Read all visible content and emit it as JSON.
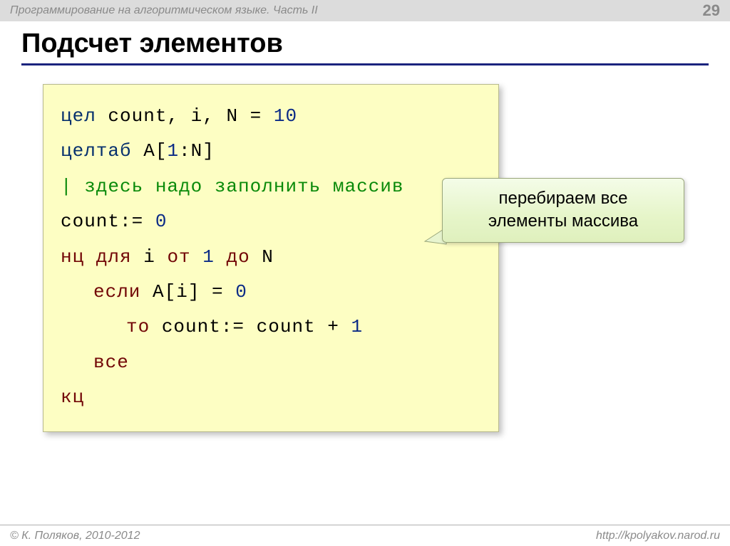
{
  "header": {
    "course": "Программирование на алгоритмическом языке. Часть II",
    "page": "29"
  },
  "title": "Подсчет элементов",
  "code": {
    "l1_kw": "цел",
    "l1_rest": " count, i, N = ",
    "l1_num": "10",
    "l2_kw": "целтаб",
    "l2_rest": " A[",
    "l2_num": "1",
    "l2_rest2": ":N]",
    "l3": "| здесь надо заполнить массив",
    "l4_a": "count:= ",
    "l4_num": "0",
    "l5_a": "нц для",
    "l5_b": " i ",
    "l5_c": "от",
    "l5_d": " ",
    "l5_num": "1",
    "l5_e": " ",
    "l5_f": "до",
    "l5_g": " N",
    "l6_a": "если",
    "l6_b": " A[i] = ",
    "l6_num": "0",
    "l7_a": "то",
    "l7_b": " count:= count + ",
    "l7_num": "1",
    "l8": "все",
    "l9": "кц"
  },
  "callout": {
    "line1": "перебираем все",
    "line2": "элементы массива"
  },
  "footer": {
    "left": "© К. Поляков, 2010-2012",
    "right": "http://kpolyakov.narod.ru"
  }
}
